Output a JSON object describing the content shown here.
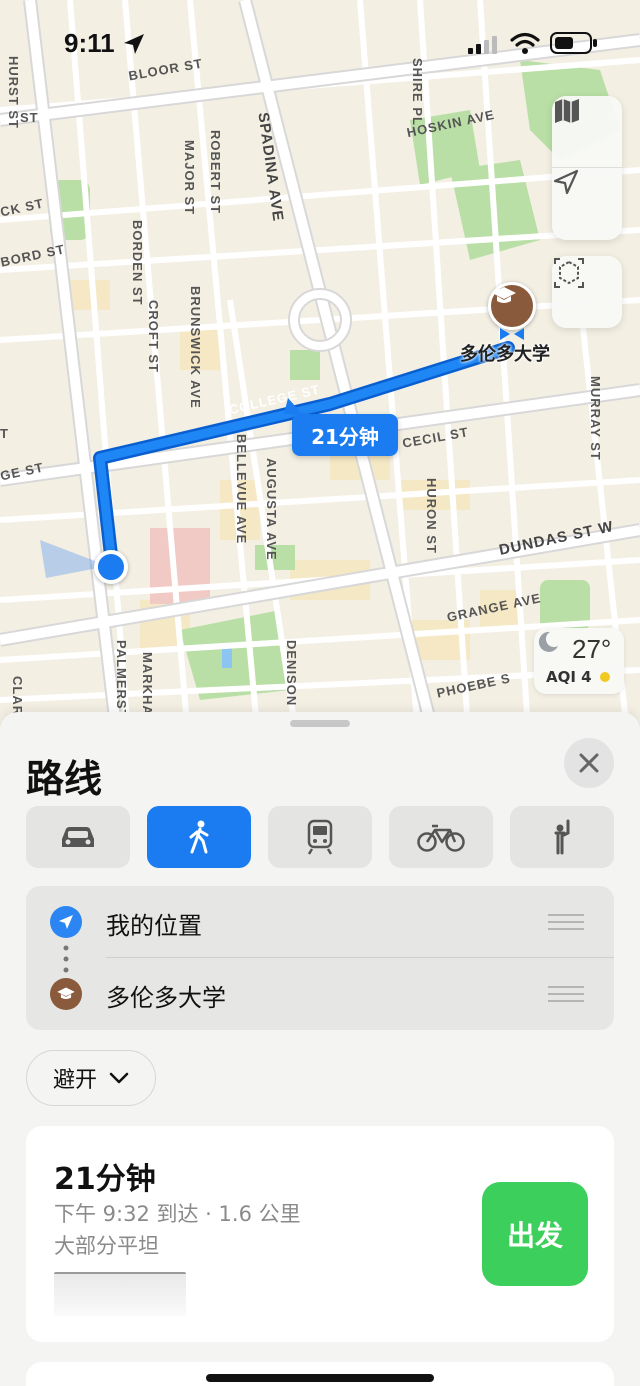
{
  "status_bar": {
    "time": "9:11"
  },
  "map": {
    "streets": {
      "bloor": "BLOOR ST",
      "hoskin": "HOSKIN AVE",
      "spadina": "SPADINA AVE",
      "major": "MAJOR ST",
      "robert": "ROBERT ST",
      "borden": "BORDEN ST",
      "croft": "CROFT ST",
      "brunswick": "BRUNSWICK AVE",
      "bathurst": "HURST ST",
      "ck": "CK ST",
      "bord": "BORD ST",
      "college": "COLLEGE ST",
      "cecil": "CECIL ST",
      "huron": "HURON ST",
      "dundas": "DUNDAS ST W",
      "grange": "GRANGE AVE",
      "phoebe": "PHOEBE S",
      "murray": "MURRAY ST",
      "bellevue": "BELLEVUE AVE",
      "augusta": "AUGUSTA AVE",
      "denison": "DENISON",
      "palmerston": "PALMERST",
      "markham": "MARKHA",
      "clar": "CLAR",
      "ge": "GE ST",
      "shire": "SHIRE PL",
      "t": "T",
      "st_left": "ST"
    },
    "destination_label": "多伦多大学",
    "route_time": "21分钟",
    "weather": {
      "temperature": "27°",
      "aqi": "AQI 4"
    }
  },
  "sheet": {
    "title": "路线",
    "modes": [
      {
        "name": "drive",
        "active": false
      },
      {
        "name": "walk",
        "active": true
      },
      {
        "name": "transit",
        "active": false
      },
      {
        "name": "cycle",
        "active": false
      },
      {
        "name": "ride-share",
        "active": false
      }
    ],
    "waypoints": {
      "origin": "我的位置",
      "destination": "多伦多大学"
    },
    "avoid_label": "避开",
    "route": {
      "duration": "21分钟",
      "meta": "下午 9:32 到达 · 1.6 公里",
      "terrain": "大部分平坦",
      "go_label": "出发"
    }
  },
  "colors": {
    "accent": "#1a7cf0",
    "go": "#3ccf5c",
    "destination": "#8a5a3c"
  }
}
